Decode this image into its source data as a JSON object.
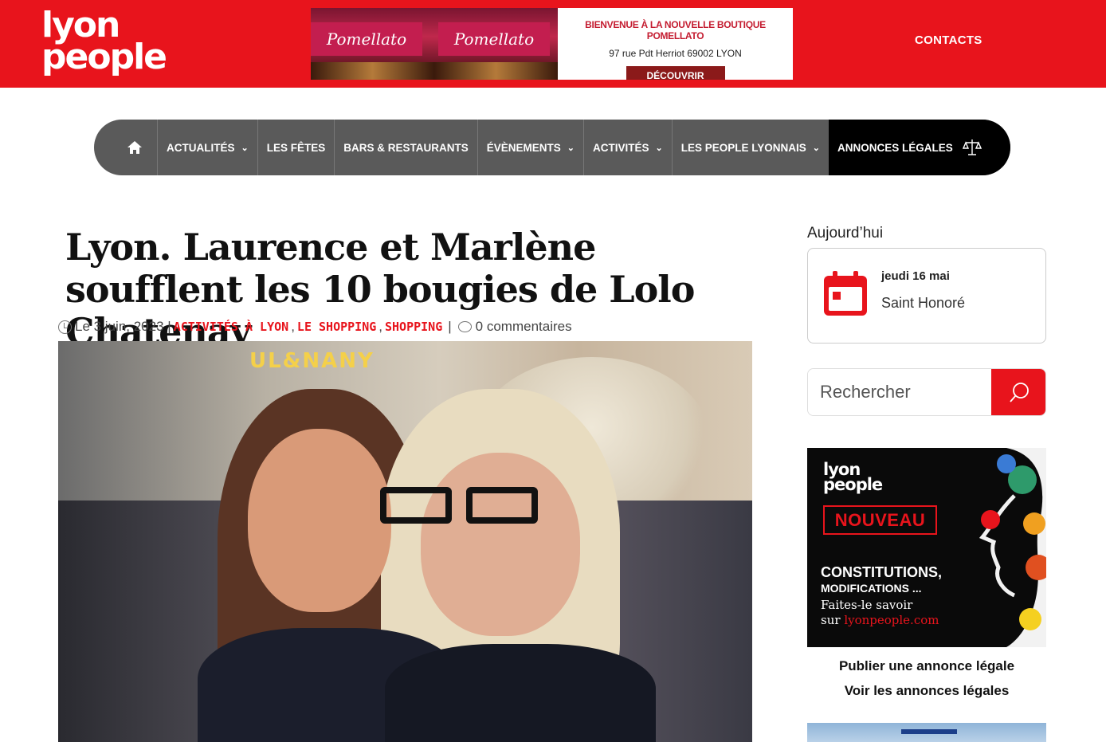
{
  "header": {
    "logo_line1": "lyon",
    "logo_line2": "people",
    "banner": {
      "awning_text": "Pomellato",
      "title": "BIENVENUE À LA NOUVELLE BOUTIQUE POMELLATO",
      "address": "97 rue Pdt Herriot 69002 LYON",
      "button": "DÉCOUVRIR"
    },
    "contacts": "CONTACTS"
  },
  "nav": {
    "items": [
      {
        "label": "ACTUALITÉS",
        "dropdown": true
      },
      {
        "label": "LES FÊTES",
        "dropdown": false
      },
      {
        "label": "BARS & RESTAURANTS",
        "dropdown": false
      },
      {
        "label": "ÉVÈNEMENTS",
        "dropdown": true
      },
      {
        "label": "ACTIVITÉS",
        "dropdown": true
      },
      {
        "label": "LES PEOPLE LYONNAIS",
        "dropdown": true
      }
    ],
    "legal": "ANNONCES LÉGALES",
    "chevron": "⌄"
  },
  "article": {
    "title": "Lyon. Laurence et Marlène soufflent les 10 bougies de Lolo Chatenay",
    "date": "Le 3 juin, 2023 |",
    "categories": [
      "Activités à Lyon",
      "Le Shopping",
      "Shopping"
    ],
    "comments": "0 commentaires",
    "photo_sign": "UL&NANY"
  },
  "sidebar": {
    "today_label": "Aujourd’hui",
    "today_date": "jeudi 16 mai",
    "today_saint": "Saint Honoré",
    "search_placeholder": "Rechercher",
    "ad": {
      "logo_line1": "lyon",
      "logo_line2": "people",
      "badge": "NOUVEAU",
      "line1": "CONSTITUTIONS,",
      "line2": "MODIFICATIONS ...",
      "line3": "Faites-le savoir",
      "line4_prefix": "sur",
      "line4_site": "lyonpeople.com"
    },
    "link_publish": "Publier une annonce légale",
    "link_view": "Voir les annonces légales"
  },
  "colors": {
    "brand_red": "#e8141c",
    "nav_grey": "#5a5a5a",
    "legal_black": "#000000"
  },
  "icons": [
    "home-icon",
    "chevron-down-icon",
    "scales-icon",
    "clock-icon",
    "comment-icon",
    "calendar-icon",
    "search-icon"
  ]
}
